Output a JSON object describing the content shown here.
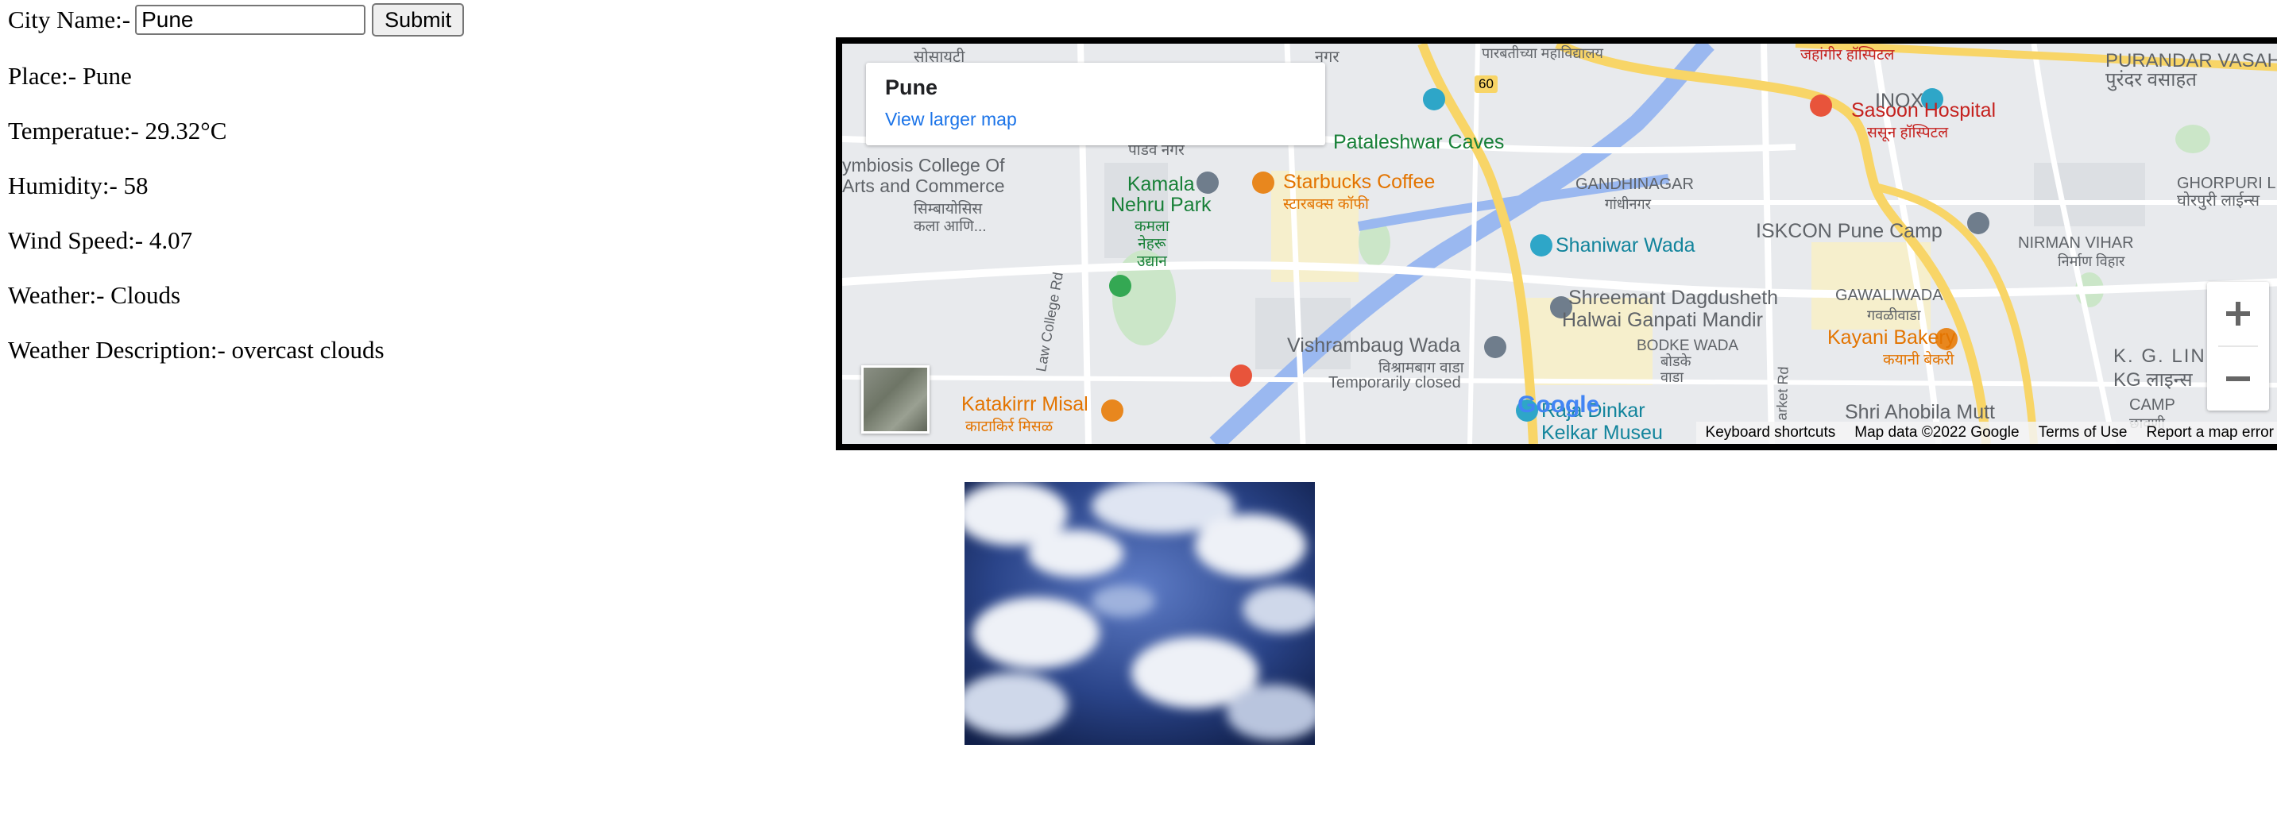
{
  "form": {
    "city_label": "City Name:-",
    "city_value": "Pune",
    "submit_label": "Submit"
  },
  "info": {
    "place": "Place:- Pune",
    "temperature": "Temperatue:- 29.32°C",
    "humidity": "Humidity:- 58",
    "wind": "Wind Speed:- 4.07",
    "weather": "Weather:- Clouds",
    "description": "Weather Description:- overcast clouds"
  },
  "map": {
    "card_title": "Pune",
    "card_link": "View larger map",
    "google": "Google",
    "footer": {
      "shortcuts": "Keyboard shortcuts",
      "data": "Map data ©2022 Google",
      "terms": "Terms of Use",
      "report": "Report a map error"
    },
    "labels": {
      "vasahat": "PURANDAR VASAHAT",
      "vasahat_mr": "पुरंदर वसाहत",
      "sasoon": "Sasoon Hospital",
      "sasoon_mr": "ससून हॉस्पिटल",
      "inox": "INOX",
      "pataleshwar": "Pataleshwar Caves",
      "symbiosis": "ymbiosis College Of",
      "arts": "Arts and Commerce",
      "symbiosis_mr": "सिम्बायोसिस",
      "kala": "कला आणि...",
      "kamala": "Kamala",
      "nehru_park": "Nehru Park",
      "kamala_mr": "कमला",
      "nehru_mr": "नेहरू",
      "udyan_mr": "उद्यान",
      "starbucks": "Starbucks Coffee",
      "starbucks_mr": "स्टारबक्स कॉफी",
      "gandhinagar": "GANDHINAGAR",
      "gandhinagar_mr": "गांधीनगर",
      "shaniwar": "Shaniwar Wada",
      "iskcon": "ISKCON Pune Camp",
      "ghorpuri": "GHORPURI LINES",
      "ghorpuri_mr": "घोरपुरी लाईन्स",
      "nirman": "NIRMAN VIHAR",
      "nirman_mr": "निर्माण विहार",
      "shreemant": "Shreemant Dagdusheth",
      "halwai": "Halwai Ganpati Mandir",
      "gawali": "GAWALIWADA",
      "gawali_mr": "गवळीवाडा",
      "vishrambaug": "Vishrambaug Wada",
      "vishrambaug_mr": "विश्रामबाग वाडा",
      "temp_closed": "Temporarily closed",
      "bodke": "BODKE WADA",
      "bodke_mr": "बोडके",
      "wada_mr": "वाडा",
      "kayani": "Kayani Bakery",
      "kayani_mr": "कयानी बेकरी",
      "kglines": "K. G. LINES",
      "kglines_mr": "KG लाइन्स",
      "camp": "CAMP",
      "camp_mr": "छावणी",
      "katakirrr": "Katakirrr Misal",
      "katakirrr_mr": "काटाकिर्र मिसळ",
      "raja": "Raja Dinkar",
      "kelkar": "Kelkar Museu",
      "ahobila": "Shri Ahobila Mutt",
      "lawcollege": "Law College Rd",
      "market": "arket Rd",
      "road60": "60",
      "top_left": "सोसायटी",
      "top_mid": "नगर",
      "wadinagar": "पाडव नगर",
      "top_right": "जहांगीर हॉस्पिटल",
      "parvati": "पारबतीच्या महाविद्यालय"
    }
  },
  "image": {
    "alt": "overcast clouds"
  }
}
